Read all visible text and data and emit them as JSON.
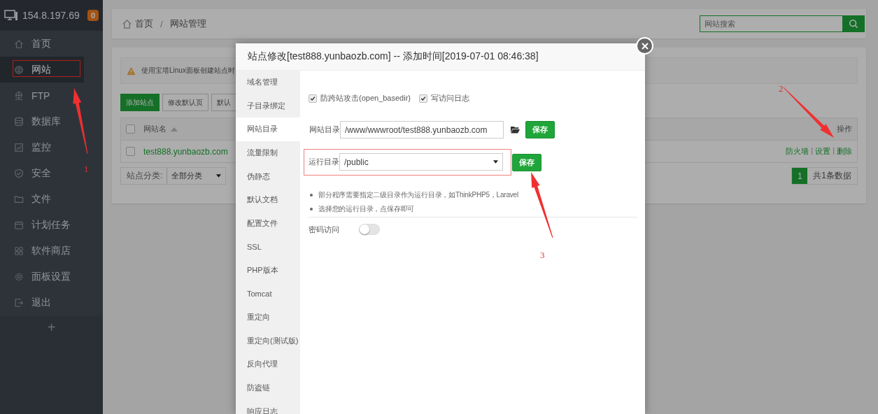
{
  "server": {
    "ip": "154.8.197.69",
    "badge": "0"
  },
  "sidebar": {
    "items": [
      {
        "label": "首页",
        "selected": false,
        "highlighted": false
      },
      {
        "label": "网站",
        "selected": true,
        "highlighted": true
      },
      {
        "label": "FTP",
        "selected": false,
        "highlighted": false
      },
      {
        "label": "数据库",
        "selected": false,
        "highlighted": false
      },
      {
        "label": "监控",
        "selected": false,
        "highlighted": false
      },
      {
        "label": "安全",
        "selected": false,
        "highlighted": false
      },
      {
        "label": "文件",
        "selected": false,
        "highlighted": false
      },
      {
        "label": "计划任务",
        "selected": false,
        "highlighted": false
      },
      {
        "label": "软件商店",
        "selected": false,
        "highlighted": false
      },
      {
        "label": "面板设置",
        "selected": false,
        "highlighted": false
      },
      {
        "label": "退出",
        "selected": false,
        "highlighted": false
      }
    ],
    "add": "+"
  },
  "breadcrumb": {
    "items": [
      "首页",
      "网站管理"
    ],
    "separator": "/"
  },
  "search": {
    "placeholder": "网站搜索"
  },
  "notice": "使用宝塔Linux面板创建站点时",
  "toolbar_buttons": [
    {
      "label": "添加站点",
      "kind": "primary"
    },
    {
      "label": "修改默认页",
      "kind": "default"
    },
    {
      "label": "默认",
      "kind": "default"
    }
  ],
  "table": {
    "select_all_checked": false,
    "columns": [
      "网站名",
      "操作"
    ],
    "rows": [
      {
        "checked": false,
        "name": "test888.yunbaozb.com",
        "actions": [
          "防火墙",
          "设置",
          "删除"
        ],
        "action_separators": [
          "|",
          "|"
        ]
      }
    ]
  },
  "category": {
    "label": "站点分类:",
    "value": "全部分类"
  },
  "pagination": {
    "pages": [
      {
        "label": "1",
        "selected": true
      }
    ],
    "total": "共1条数据"
  },
  "modal": {
    "title": "站点修改[test888.yunbaozb.com] -- 添加时间[2019-07-01 08:46:38]",
    "tabs": [
      {
        "label": "域名管理",
        "selected": false
      },
      {
        "label": "子目录绑定",
        "selected": false
      },
      {
        "label": "网站目录",
        "selected": true
      },
      {
        "label": "流量限制",
        "selected": false
      },
      {
        "label": "伪静态",
        "selected": false
      },
      {
        "label": "默认文档",
        "selected": false
      },
      {
        "label": "配置文件",
        "selected": false
      },
      {
        "label": "SSL",
        "selected": false
      },
      {
        "label": "PHP版本",
        "selected": false
      },
      {
        "label": "Tomcat",
        "selected": false
      },
      {
        "label": "重定向",
        "selected": false
      },
      {
        "label": "重定向(测试版)",
        "selected": false
      },
      {
        "label": "反向代理",
        "selected": false
      },
      {
        "label": "防盗链",
        "selected": false
      },
      {
        "label": "响应日志",
        "selected": false
      }
    ],
    "options": [
      {
        "label": "防跨站攻击(open_basedir)",
        "checked": true
      },
      {
        "label": "写访问日志",
        "checked": true
      }
    ],
    "site_dir": {
      "label": "网站目录",
      "value": "/www/wwwroot/test888.yunbaozb.com",
      "button": "保存"
    },
    "run_dir": {
      "label": "运行目录",
      "value": "/public",
      "button": "保存",
      "highlighted": true
    },
    "tips": [
      "部分程序需要指定二级目录作为运行目录，如ThinkPHP5，Laravel",
      "选择您的运行目录，点保存即可"
    ],
    "password_access": {
      "label": "密码访问",
      "on": false
    }
  },
  "annotations": [
    {
      "label": "1"
    },
    {
      "label": "2"
    },
    {
      "label": "3"
    }
  ]
}
